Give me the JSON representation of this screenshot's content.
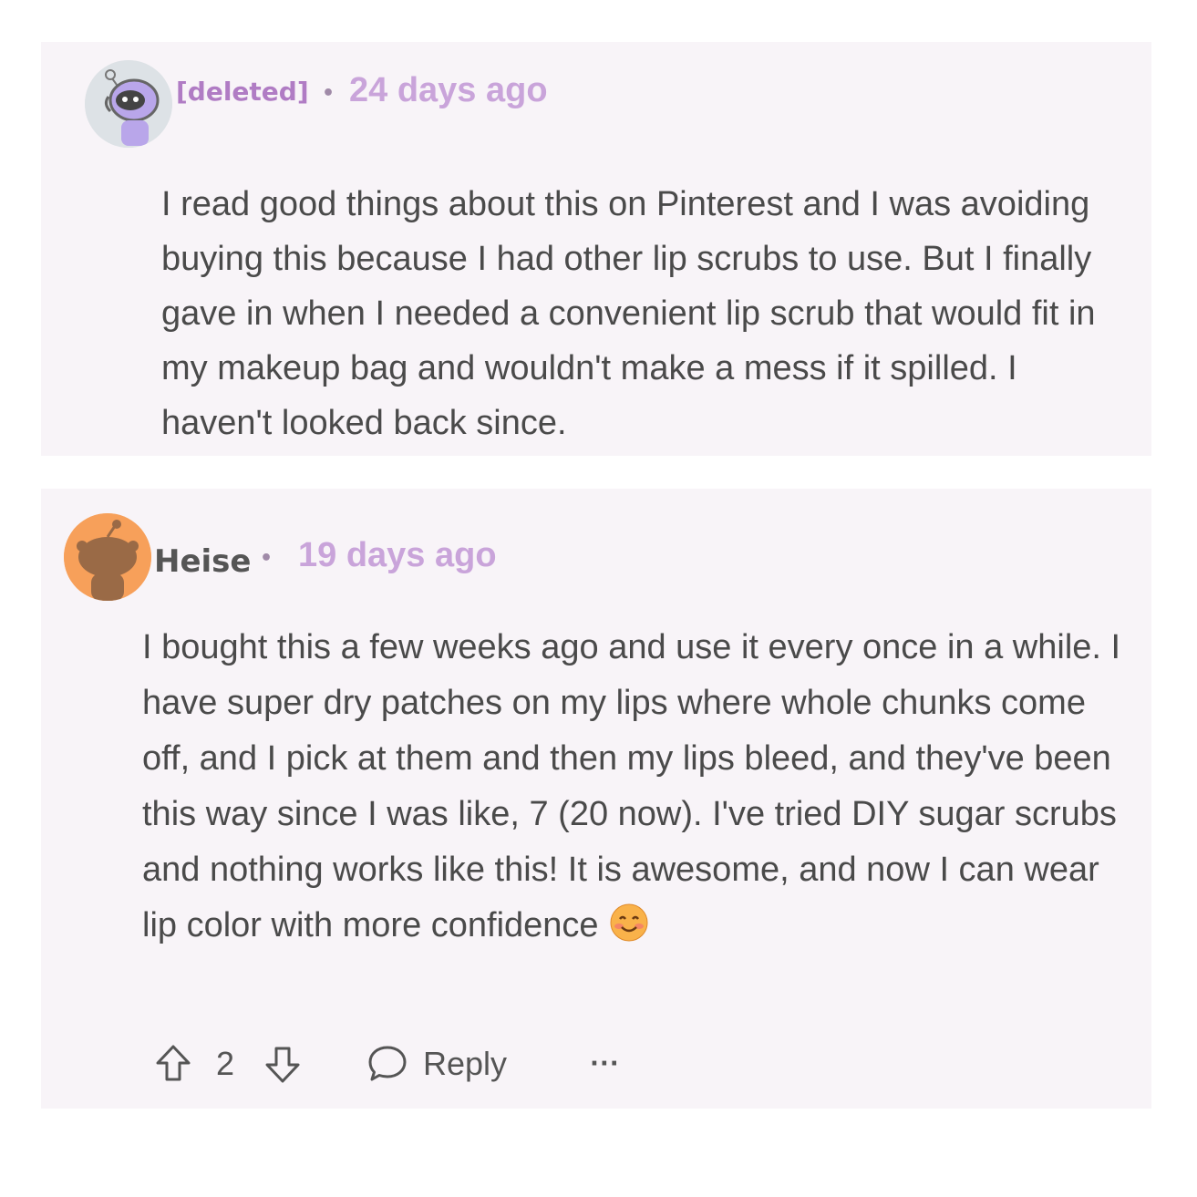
{
  "comments": [
    {
      "author": "[deleted]",
      "separator": "•",
      "time": "24 days ago",
      "body": "I read good things about this on Pinterest and I was avoiding buying this because I had other lip scrubs to use. But I finally gave in when I needed a convenient lip scrub that would fit in my makeup bag and wouldn't make a mess if it spilled. I haven't looked back since.",
      "avatar_icon": "snoo-astronaut-avatar"
    },
    {
      "author": "Heise",
      "separator": "•",
      "time": "19 days ago",
      "body": "I bought this a few weeks ago and use it every once in a while. I have super dry patches on my lips where whole chunks come off, and I pick at them and then my lips bleed, and they've been this way since I was like, 7 (20 now). I've tried DIY sugar scrubs and nothing works like this! It is awesome, and now I can wear lip color with more confidence",
      "avatar_icon": "snoo-avatar",
      "emoji": "smiling-face-emoji",
      "score": "2",
      "reply_label": "Reply",
      "more_label": "···"
    }
  ],
  "colors": {
    "card_bg": "#f8f4f8",
    "timestamp": "#c9a4da",
    "deleted_author": "#b07cc4",
    "avatar_orange": "#f7a05a"
  }
}
